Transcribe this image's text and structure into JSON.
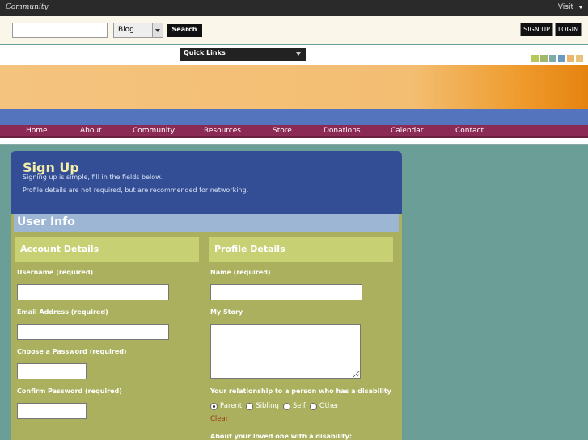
{
  "topbar": {
    "brand": "Community",
    "visit": "Visit"
  },
  "search": {
    "input_value": "",
    "select_value": "Blog",
    "button_label": "Search"
  },
  "auth": {
    "signup": "SIGN UP",
    "login": "LOGIN"
  },
  "quick_links": "Quick Links",
  "swatch_colors": [
    "#b5c95a",
    "#9fb86a",
    "#7fa9a8",
    "#6a9ac2",
    "#e9b66a",
    "#e9c27a"
  ],
  "nav": [
    "Home",
    "About",
    "Community",
    "Resources",
    "Store",
    "Donations",
    "Calendar",
    "Contact"
  ],
  "signup": {
    "title": "Sign Up",
    "line1": "Signing up is simple, fill in the fields below.",
    "line2": "Profile details are not required, but are recommended for networking."
  },
  "user_info": "User Info",
  "account": {
    "heading": "Account Details",
    "username_label": "Username (required)",
    "email_label": "Email Address (required)",
    "password_label": "Choose a Password (required)",
    "confirm_label": "Confirm Password (required)"
  },
  "profile": {
    "heading": "Profile Details",
    "name_label": "Name (required)",
    "story_label": "My Story",
    "relationship_label": "Your relationship to a person who has a disability",
    "options": [
      "Parent",
      "Sibling",
      "Self",
      "Other"
    ],
    "selected": "Parent",
    "clear": "Clear",
    "loved_one_label": "About your loved one with a disability:"
  }
}
